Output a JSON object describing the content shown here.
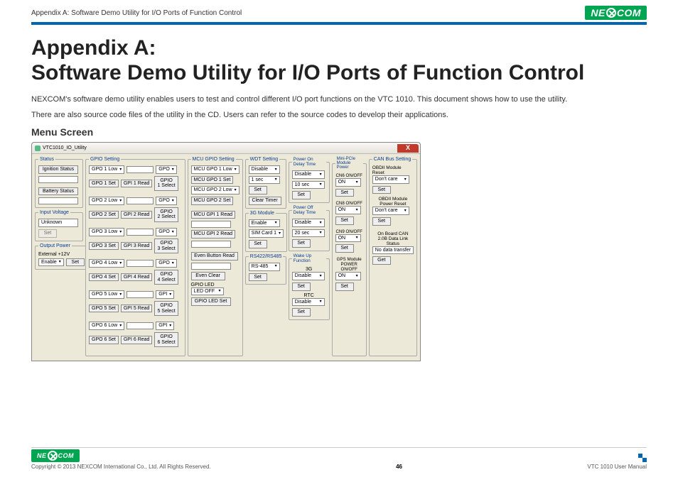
{
  "header": {
    "doc_section": "Appendix A: Software Demo Utility for I/O Ports of Function Control",
    "brand": "NEXCOM"
  },
  "title_line1": "Appendix A:",
  "title_line2": "Software Demo Utility for I/O Ports of Function Control",
  "para1": "NEXCOM's software demo utility enables users to test and control different I/O port functions on the VTC 1010. This document shows how to use the utility.",
  "para2": "There are also source code files of the utility in the CD. Users can refer to the source codes to develop their applications.",
  "subhead": "Menu Screen",
  "win": {
    "title": "VTC1010_IO_Utility",
    "close": "X",
    "status": {
      "legend": "Status",
      "ignition_btn": "Ignition Status",
      "ignition_val": "",
      "battery_btn": "Battery Status",
      "battery_val": ""
    },
    "inputv": {
      "legend": "Input Voltage",
      "val": "Unknown",
      "set": "Set"
    },
    "outputp": {
      "legend": "Output Power",
      "label": "External +12V",
      "sel": "Enable",
      "set": "Set"
    },
    "gpio": {
      "legend": "GPIO Setting",
      "rows": [
        {
          "sel": "GPO 1 Low",
          "gpo": "GPO",
          "set": "GPO 1 Set",
          "read": "GPI 1 Read",
          "selbtn": "GPIO 1 Select"
        },
        {
          "sel": "GPO 2 Low",
          "gpo": "GPO",
          "set": "GPO 2 Set",
          "read": "GPI 2 Read",
          "selbtn": "GPIO 2 Select"
        },
        {
          "sel": "GPO 3 Low",
          "gpo": "GPO",
          "set": "GPO 3 Set",
          "read": "GPI 3 Read",
          "selbtn": "GPIO 3 Select"
        },
        {
          "sel": "GPO 4 Low",
          "gpo": "GPO",
          "set": "GPO 4 Set",
          "read": "GPI 4 Read",
          "selbtn": "GPIO 4 Select"
        },
        {
          "sel": "GPO 5 Low",
          "gpi": "GPI",
          "set": "GPO 5 Set",
          "read": "GPI 5 Read",
          "selbtn": "GPIO 5 Select"
        },
        {
          "sel": "GPO 6 Low",
          "gpi": "GPI",
          "set": "GPO 6 Set",
          "read": "GPI 6 Read",
          "selbtn": "GPIO 6 Select"
        }
      ]
    },
    "mcugpio": {
      "legend": "MCU GPIO Setting",
      "gpo1_sel": "MCU GPO 1 Low",
      "gpo1_set": "MCU GPO 1 Set",
      "gpo2_sel": "MCU GPO 2 Low",
      "gpo2_set": "MCU GPO 2 Set",
      "gpi1_read": "MCU GPI 1 Read",
      "gpi1_val": "",
      "gpi2_read": "MCU GPI 2 Read",
      "gpi2_val": "",
      "evb_read": "Even Button Read",
      "evb_val": "",
      "ev_clear": "Even Clear",
      "led_label": "GPIO LED",
      "led_sel": "LED OFF",
      "led_set": "GPIO LED Set"
    },
    "wdt": {
      "legend": "WDT Setting",
      "en": "Disable",
      "time": "1 sec",
      "set": "Set",
      "clear": "Clear Timer"
    },
    "mod3g": {
      "legend": "3G Module",
      "en": "Enable",
      "sim": "SIM Card 1",
      "set": "Set"
    },
    "rs": {
      "legend": "RS422/RS485",
      "sel": "RS-485",
      "set": "Set"
    },
    "pon": {
      "legend": "Power On Delay Time",
      "en": "Disable",
      "t": "10 sec",
      "set": "Set"
    },
    "poff": {
      "legend": "Power Off Delay Time",
      "en": "Disable",
      "t": "20 sec",
      "set": "Set"
    },
    "wake": {
      "legend": "Wake Up Function",
      "l3g": "3G",
      "v3g": "Disable",
      "set1": "Set",
      "lrtc": "RTC",
      "vrtc": "Disable",
      "set2": "Set"
    },
    "mini": {
      "legend": "Mini-PCIe Module Power",
      "items": [
        {
          "lbl": "CN6 ON/OFF",
          "sel": "ON",
          "set": "Set"
        },
        {
          "lbl": "CN8 ON/OFF",
          "sel": "ON",
          "set": "Set"
        },
        {
          "lbl": "CN9 ON/OFF",
          "sel": "ON",
          "set": "Set"
        },
        {
          "lbl": "GPS Module POWER ON/OFF",
          "sel": "ON",
          "set": "Set"
        }
      ]
    },
    "can": {
      "legend": "CAN Bus Setting",
      "l1": "OBDII Module Reset",
      "s1": "Don't care",
      "b1": "Set",
      "l2": "OBDII Module Power Reset",
      "s2": "Don't care",
      "b2": "Set",
      "l3": "On Board CAN 2.0B Data Link Status",
      "v3": "No data transfer",
      "b3": "Get"
    }
  },
  "footer": {
    "copyright": "Copyright © 2013 NEXCOM International Co., Ltd. All Rights Reserved.",
    "page": "46",
    "doc": "VTC 1010 User Manual",
    "brand": "NEXCOM"
  }
}
